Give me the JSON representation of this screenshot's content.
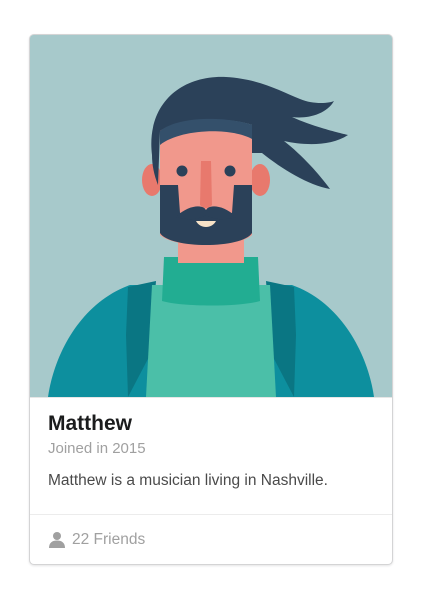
{
  "card": {
    "name": "Matthew",
    "meta": "Joined in 2015",
    "description": "Matthew is a musician living in Nashville.",
    "friends_label": "22 Friends",
    "friends_icon": "user-icon",
    "image_subject": "avatar-illustration"
  },
  "colors": {
    "image_background": "#a7c9cb",
    "hair": "#2b4159",
    "skin": "#f1988c",
    "shirt": "#4bbfa8",
    "jacket": "#0d8f9e",
    "meta_text": "#a0a0a0"
  }
}
